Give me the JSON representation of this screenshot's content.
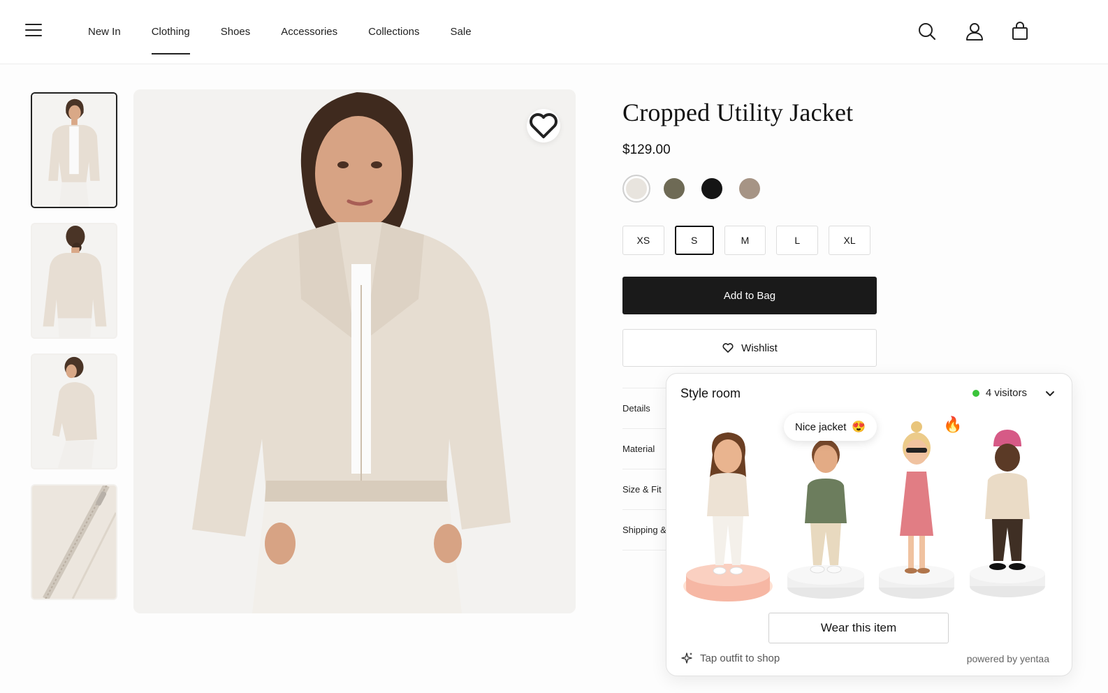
{
  "header": {
    "menu_icon": "hamburger-icon",
    "nav": [
      "New In",
      "Clothing",
      "Shoes",
      "Accessories",
      "Collections",
      "Sale"
    ],
    "active_nav": "Clothing",
    "icons": [
      "search-icon",
      "account-icon",
      "bag-icon"
    ]
  },
  "gallery": {
    "thumbnails": [
      "front view",
      "back view",
      "side view",
      "zipper detail"
    ],
    "selected_thumbnail": 0,
    "favorite_icon": "heart-icon"
  },
  "product": {
    "title": "Cropped Utility Jacket",
    "price": "$129.00",
    "colors": [
      "#e8e4de",
      "#6e6a55",
      "#151515",
      "#a69485"
    ],
    "selected_color": 0,
    "sizes": [
      "XS",
      "S",
      "M",
      "L",
      "XL"
    ],
    "selected_size": "S",
    "add_to_bag_label": "Add to Bag",
    "wishlist_label": "Wishlist",
    "accordion": [
      "Details",
      "Material",
      "Size & Fit",
      "Shipping &"
    ]
  },
  "style_room": {
    "title": "Style room",
    "visitors_label": "4 visitors",
    "status_color": "#3bc43b",
    "bubble_text": "Nice jacket",
    "bubble_emoji": "😍",
    "reaction_emoji": "🔥",
    "wear_label": "Wear this item",
    "tap_label": "Tap outfit to shop",
    "powered_label": "powered by yentaa",
    "avatars": [
      "avatar-woman-jacket",
      "avatar-boy-green-sweater",
      "avatar-girl-pink-dress",
      "avatar-man-beanie-hoodie"
    ]
  }
}
